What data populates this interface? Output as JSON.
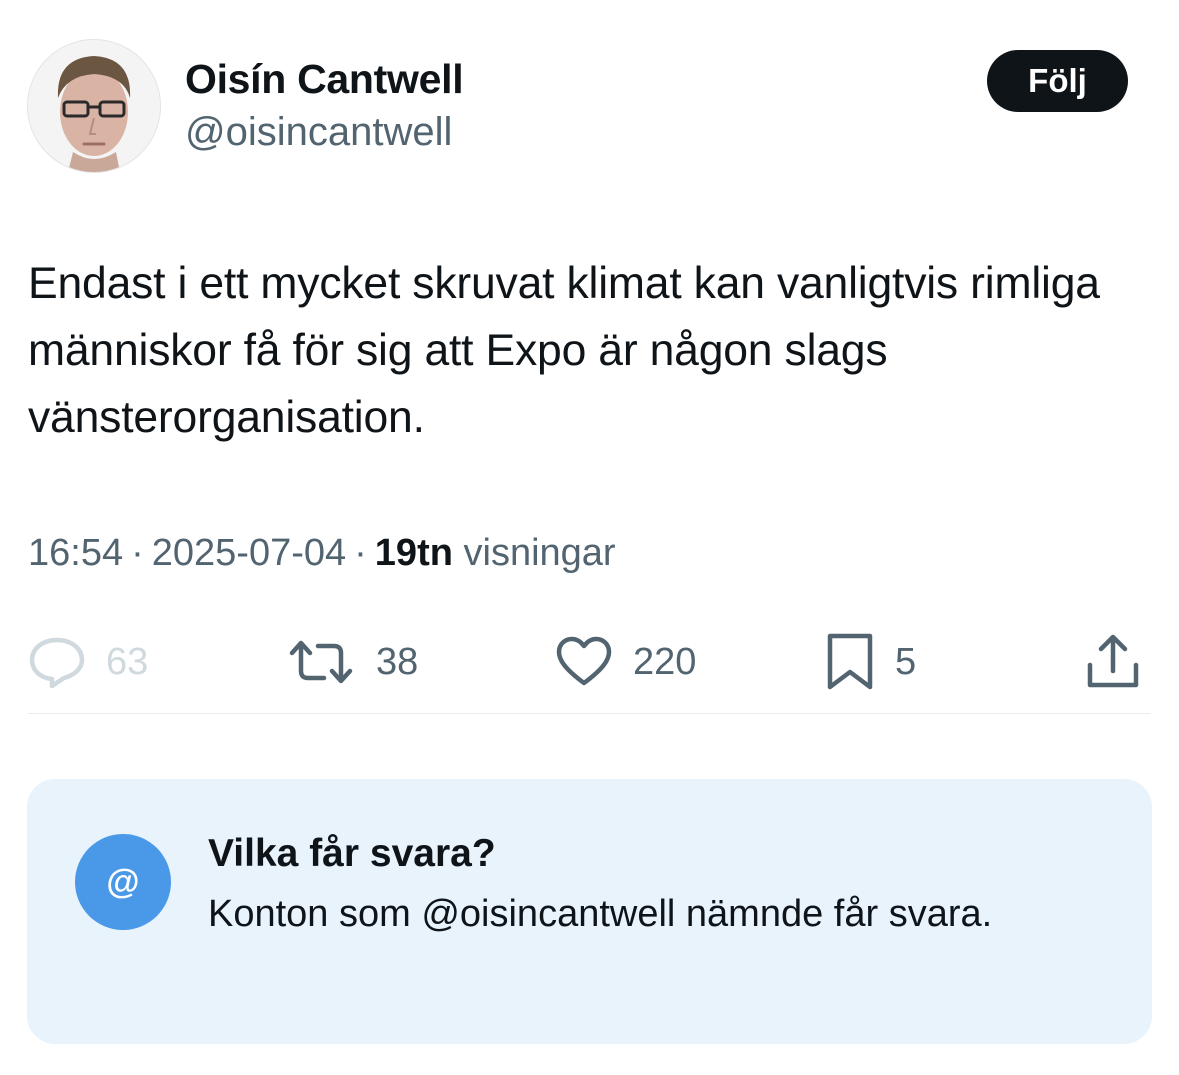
{
  "author": {
    "display_name": "Oisín Cantwell",
    "handle": "@oisincantwell",
    "avatar_icon": "profile-photo"
  },
  "follow_button": {
    "label": "Följ"
  },
  "tweet": {
    "text": "Endast i ett mycket skruvat klimat kan vanligtvis rimliga människor få för sig att Expo är någon slags vänsterorganisation."
  },
  "meta": {
    "time": "16:54",
    "separator": "·",
    "date": "2025-07-04",
    "views_count": "19tn",
    "views_label": "visningar"
  },
  "actions": {
    "reply": {
      "icon": "reply-icon",
      "count": "63"
    },
    "retweet": {
      "icon": "retweet-icon",
      "count": "38"
    },
    "like": {
      "icon": "heart-icon",
      "count": "220"
    },
    "bookmark": {
      "icon": "bookmark-icon",
      "count": "5"
    },
    "share": {
      "icon": "share-icon"
    }
  },
  "reply_restriction": {
    "icon_glyph": "@",
    "title": "Vilka får svara?",
    "body": "Konton som @oisincantwell nämnde får svara."
  },
  "colors": {
    "text_primary": "#0f1419",
    "text_secondary": "#536471",
    "follow_bg": "#0f1419",
    "card_bg": "#e8f3fc",
    "card_icon_bg": "#4a99e9"
  }
}
